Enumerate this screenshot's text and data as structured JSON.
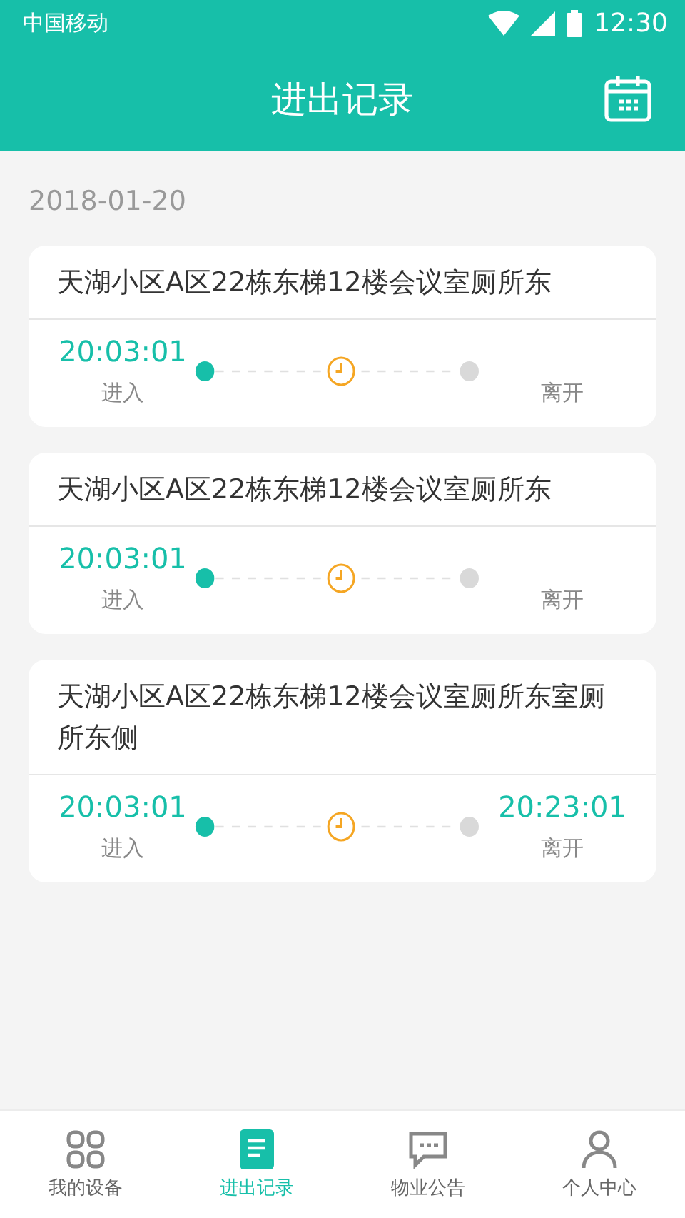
{
  "status_bar": {
    "carrier": "中国移动",
    "time": "12:30"
  },
  "header": {
    "title": "进出记录"
  },
  "date": "2018-01-20",
  "records": [
    {
      "place": "天湖小区A区22栋东梯12楼会议室厕所东",
      "entry_time": "20:03:01",
      "entry_label": "进入",
      "exit_label": "离开"
    },
    {
      "place": "天湖小区A区22栋东梯12楼会议室厕所东",
      "entry_time": "20:03:01",
      "entry_label": "进入",
      "exit_label": "离开"
    },
    {
      "place": "天湖小区A区22栋东梯12楼会议室厕所东室厕所东侧",
      "entry_time": "20:03:01",
      "entry_label": "进入",
      "exit_time": "20:23:01",
      "exit_label": "离开"
    }
  ],
  "tabs": [
    {
      "label": "我的设备",
      "kind": "devices",
      "selected": false
    },
    {
      "label": "进出记录",
      "kind": "records",
      "selected": true
    },
    {
      "label": "物业公告",
      "kind": "notices",
      "selected": false
    },
    {
      "label": "个人中心",
      "kind": "profile",
      "selected": false
    }
  ]
}
